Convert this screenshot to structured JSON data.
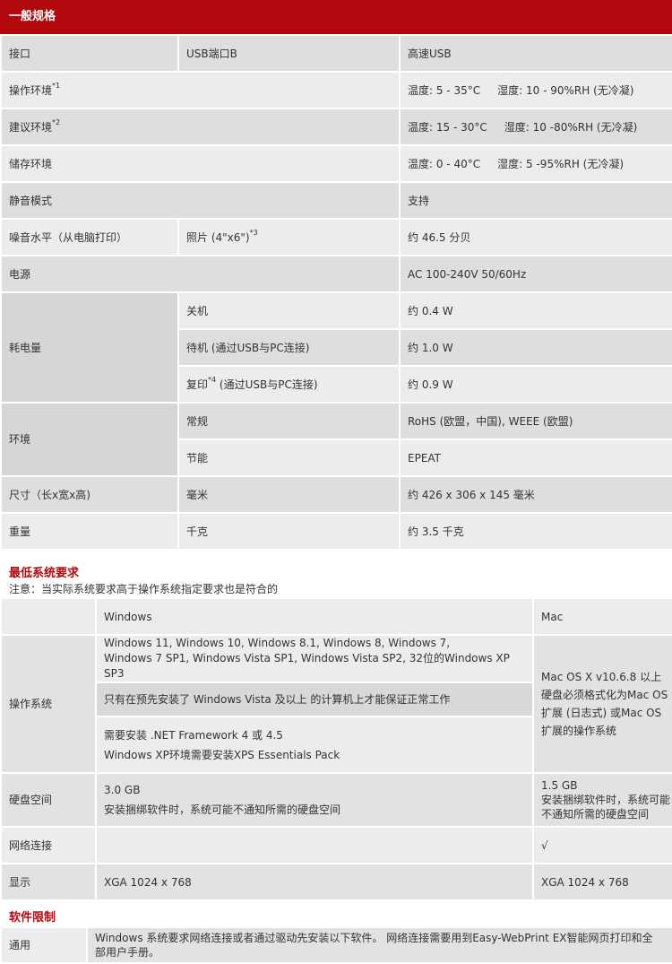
{
  "general": {
    "title": "一般规格",
    "rows": [
      {
        "label": "接口",
        "sub": "USB端口B",
        "value": "高速USB"
      },
      {
        "label": "操作环境",
        "sup": "*1",
        "value": "温度: 5 - 35°C     湿度: 10 - 90%RH (无冷凝)"
      },
      {
        "label": "建议环境",
        "sup": "*2",
        "value": "温度: 15 - 30°C     湿度: 10 -80%RH (无冷凝)"
      },
      {
        "label": "储存环境",
        "value": "温度: 0 - 40°C     湿度: 5 -95%RH (无冷凝)"
      },
      {
        "label": "静音模式",
        "value": "支持"
      },
      {
        "label": "噪音水平（从电脑打印）",
        "sub": "照片 (4\"x6\")",
        "sub_sup": "*3",
        "value": "约 46.5 分贝"
      },
      {
        "label": "电源",
        "value": "AC 100-240V 50/60Hz"
      }
    ],
    "power": {
      "label": "耗电量",
      "items": [
        {
          "sub": "关机",
          "value": "约 0.4 W"
        },
        {
          "sub": "待机 (通过USB与PC连接)",
          "value": "约 1.0 W"
        },
        {
          "sub_pre": "复印",
          "sub_sup": "*4",
          "sub_post": " (通过USB与PC连接)",
          "value": "约 0.9 W"
        }
      ]
    },
    "env": {
      "label": "环境",
      "items": [
        {
          "sub": "常规",
          "value": "RoHS (欧盟，中国), WEEE (欧盟)"
        },
        {
          "sub": "节能",
          "value": "EPEAT"
        }
      ]
    },
    "tail": [
      {
        "label": "尺寸（长x宽x高)",
        "sub": "毫米",
        "value": "约 426 x 306 x 145 毫米"
      },
      {
        "label": "重量",
        "sub": "千克",
        "value": "约 3.5 千克"
      }
    ]
  },
  "system": {
    "title": "最低系统要求",
    "note": "注意：当实际系统要求高于操作系统指定要求也是符合的",
    "header": {
      "windows": "Windows",
      "mac": "Mac"
    },
    "os": {
      "label": "操作系统",
      "win_line1": "Windows 11, Windows 10, Windows 8.1, Windows 8, Windows 7,",
      "win_line2": "Windows 7 SP1, Windows Vista SP1, Windows Vista SP2, 32位的Windows XP SP3",
      "win_vista": "只有在预先安装了 Windows Vista 及以上 的计算机上才能保证正常工作",
      "win_net1": "需要安装 .NET Framework 4 或 4.5",
      "win_net2": "Windows XP环境需要安装XPS Essentials Pack",
      "mac_line1": "Mac OS X v10.6.8 以上",
      "mac_line2": "硬盘必须格式化为Mac OS扩展 (日志式) 或Mac OS扩展的操作系统"
    },
    "disk": {
      "label": "硬盘空间",
      "win_size": "3.0 GB",
      "win_note": "安装捆绑软件时，系统可能不通知所需的硬盘空间",
      "mac_size": "1.5 GB",
      "mac_note": "安装捆绑软件时，系统可能不通知所需的硬盘空间"
    },
    "network": {
      "label": "网络连接",
      "win": "",
      "mac": "√"
    },
    "display": {
      "label": "显示",
      "win": "XGA 1024 x 768",
      "mac": "XGA 1024 x 768"
    }
  },
  "software": {
    "title": "软件限制",
    "label": "通用",
    "text": "Windows 系统要求网络连接或者通过驱动先安装以下软件。 网络连接需要用到Easy-WebPrint EX智能网页打印和全部用户手册。"
  }
}
